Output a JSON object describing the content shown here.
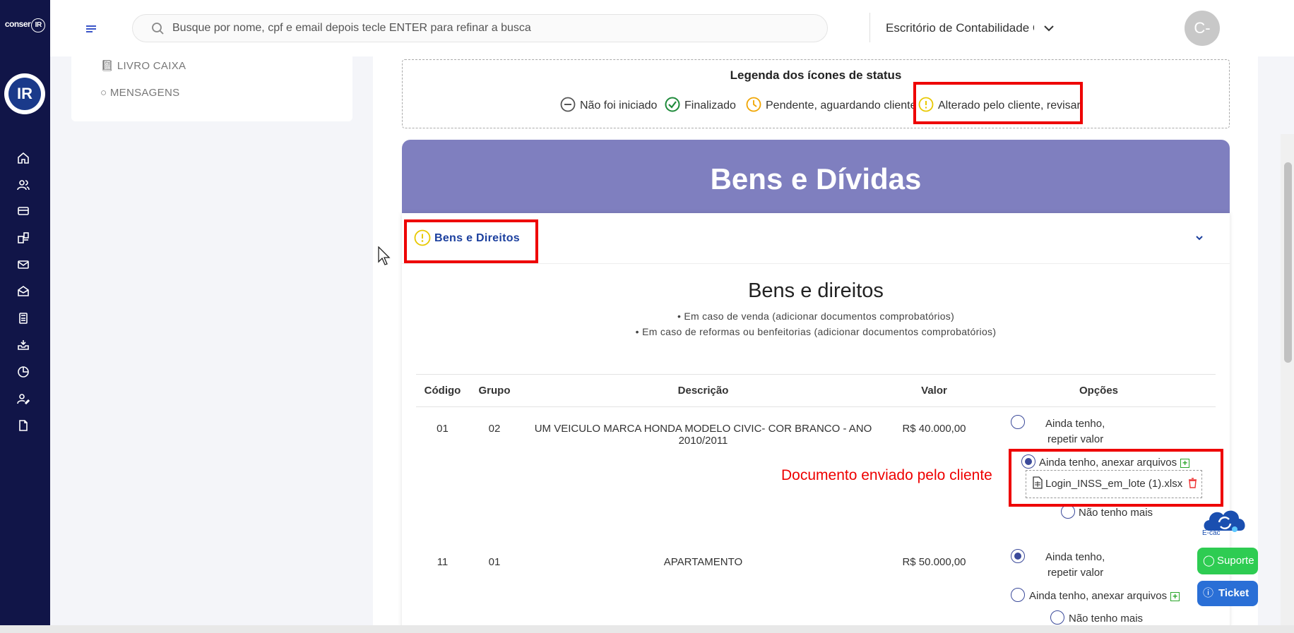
{
  "app": {
    "logo_text": "conser",
    "logo_badge": "IR",
    "rail_badge": "IR"
  },
  "header": {
    "search_placeholder": "Busque por nome, cpf e email depois tecle ENTER para refinar a busca",
    "office_name": "Escritório de Contabilidade Co",
    "avatar_initials": "C-"
  },
  "side_menu": {
    "items": [
      {
        "icon": "book-icon",
        "label": "LIVRO CAIXA"
      },
      {
        "icon": "chat-bubble-icon",
        "label": "MENSAGENS"
      }
    ]
  },
  "legend": {
    "title": "Legenda dos ícones de status",
    "items": [
      {
        "icon": "minus-circle-icon",
        "label": "Não foi iniciado",
        "color": "#555555"
      },
      {
        "icon": "check-circle-icon",
        "label": "Finalizado",
        "color": "#1e8a3a"
      },
      {
        "icon": "clock-icon",
        "label": "Pendente, aguardando cliente",
        "color": "#f0a500"
      },
      {
        "icon": "warning-circle-icon",
        "label": "Alterado pelo cliente, revisar",
        "color": "#e8c800"
      }
    ]
  },
  "section": {
    "header_title": "Bens e Dívidas",
    "header_color": "#7f7fbf",
    "accordion_title": "Bens e Direitos",
    "inner_title": "Bens e direitos",
    "notes": [
      "• Em caso de venda (adicionar documentos comprobatórios)",
      "• Em caso de reformas ou benfeitorias (adicionar documentos comprobatórios)"
    ]
  },
  "table": {
    "headers": [
      "Código",
      "Grupo",
      "Descrição",
      "Valor",
      "Opções"
    ],
    "rows": [
      {
        "codigo": "01",
        "grupo": "02",
        "descricao": "UM VEICULO MARCA HONDA MODELO CIVIC- COR BRANCO - ANO 2010/2011",
        "valor": "R$ 40.000,00",
        "opt_repeat_line1": "Ainda tenho,",
        "opt_repeat_line2": "repetir valor",
        "opt_attach": "Ainda tenho, anexar arquivos",
        "opt_none": "Não tenho mais",
        "selected": "attach",
        "file": "Login_INSS_em_lote (1).xlsx"
      },
      {
        "codigo": "11",
        "grupo": "01",
        "descricao": "APARTAMENTO",
        "valor": "R$ 50.000,00",
        "opt_repeat_line1": "Ainda tenho,",
        "opt_repeat_line2": "repetir valor",
        "opt_attach": "Ainda tenho, anexar arquivos",
        "opt_none": "Não tenho mais",
        "selected": "repeat"
      }
    ]
  },
  "annotation": {
    "text": "Documento enviado pelo cliente",
    "color": "#ee0000"
  },
  "widgets": {
    "ecac_label": "E-cac",
    "suporte_label": "Suporte",
    "ticket_label": "Ticket"
  }
}
